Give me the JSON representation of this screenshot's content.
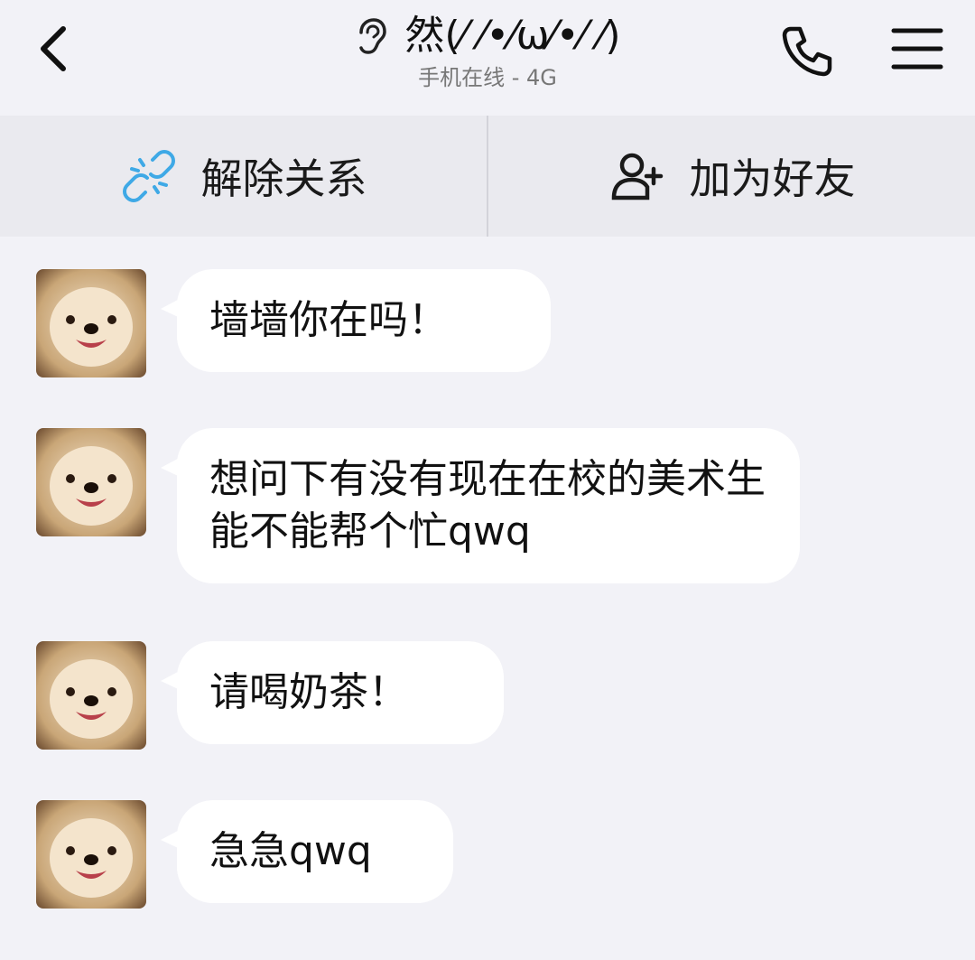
{
  "header": {
    "contact_name": "然(⁄ ⁄•⁄ω⁄•⁄ ⁄)",
    "status": "手机在线 - 4G",
    "icons": {
      "back": "chevron-left-icon",
      "ear": "ear-icon",
      "call": "phone-icon",
      "menu": "hamburger-menu-icon"
    }
  },
  "actions": {
    "unlink_label": "解除关系",
    "add_friend_label": "加为好友",
    "colors": {
      "unlink_icon": "#3fa9e6",
      "add_friend_icon": "#1a1a1a"
    }
  },
  "messages": [
    {
      "text": "墙墙你在吗！"
    },
    {
      "text": "想问下有没有现在在校的美术生能不能帮个忙qwq"
    },
    {
      "text": "请喝奶茶！"
    },
    {
      "text": "急急qwq"
    }
  ],
  "colors": {
    "background": "#f2f2f7",
    "bubble": "#ffffff",
    "action_bar": "#eaeaef"
  }
}
